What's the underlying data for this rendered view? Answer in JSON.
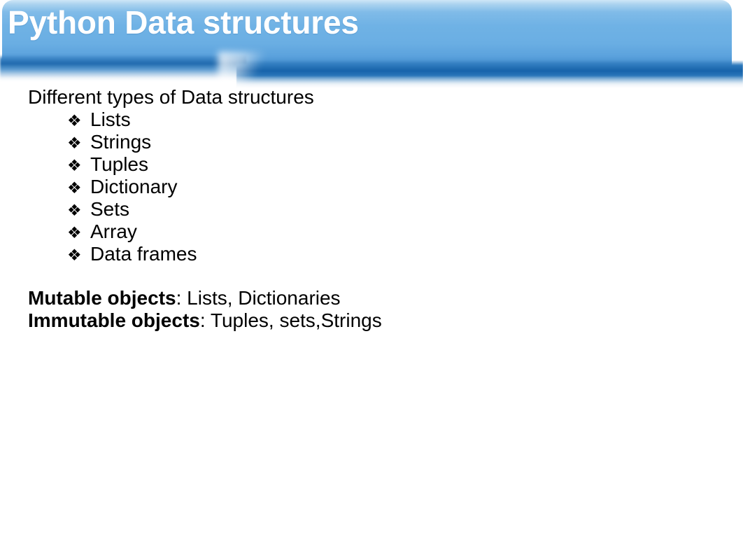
{
  "slide": {
    "background_color": "#ffffff",
    "header": {
      "title": "Python Data structures",
      "title_color": "#ffffff",
      "band_light_color": "#6fb2e5",
      "band_dark_color": "#1763ab"
    },
    "body": {
      "intro": "Different types of Data structures",
      "bullet_glyph": "❖",
      "bullet_glyph_name": "diamond-bullet-icon",
      "items": [
        {
          "label": "Lists"
        },
        {
          "label": "Strings"
        },
        {
          "label": "Tuples"
        },
        {
          "label": "Dictionary"
        },
        {
          "label": "Sets"
        },
        {
          "label": "Array"
        },
        {
          "label": "Data frames"
        }
      ],
      "notes": [
        {
          "term": "Mutable objects",
          "value": ": Lists, Dictionaries"
        },
        {
          "term": "Immutable objects",
          "value": ": Tuples, sets,Strings"
        }
      ]
    }
  }
}
